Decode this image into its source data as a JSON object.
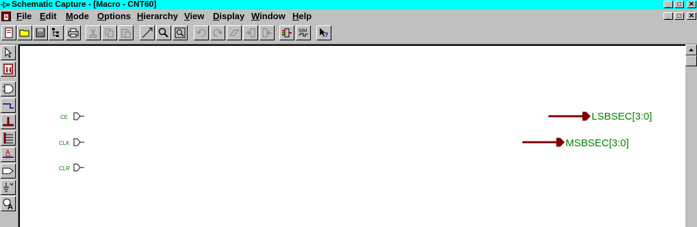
{
  "window": {
    "title": "Schematic Capture - [Macro - CNT60]",
    "controls": [
      "_",
      "□",
      "✕"
    ]
  },
  "menu": [
    {
      "label": "File",
      "accel": "F",
      "rest": "ile"
    },
    {
      "label": "Edit",
      "accel": "E",
      "rest": "dit"
    },
    {
      "label": "Mode",
      "accel": "M",
      "rest": "ode"
    },
    {
      "label": "Options",
      "accel": "O",
      "rest": "ptions"
    },
    {
      "label": "Hierarchy",
      "accel": "H",
      "rest": "ierarchy"
    },
    {
      "label": "View",
      "accel": "V",
      "rest": "iew"
    },
    {
      "label": "Display",
      "accel": "D",
      "rest": "isplay"
    },
    {
      "label": "Window",
      "accel": "W",
      "rest": "indow"
    },
    {
      "label": "Help",
      "accel": "H",
      "rest": "elp"
    }
  ],
  "toolbar": {
    "sim_label": "SIM"
  },
  "lefttools": {
    "hier_label": "H",
    "text_label": "A"
  },
  "schematic": {
    "inputs": [
      {
        "label": "CE"
      },
      {
        "label": "CLK"
      },
      {
        "label": "CLR"
      }
    ],
    "outputs": [
      {
        "label": "LSBSEC[3:0]"
      },
      {
        "label": "MSBSEC[3:0]"
      }
    ]
  },
  "colors": {
    "titlebar": "#00ffff",
    "bus": "#800000",
    "label_green": "#008000"
  }
}
